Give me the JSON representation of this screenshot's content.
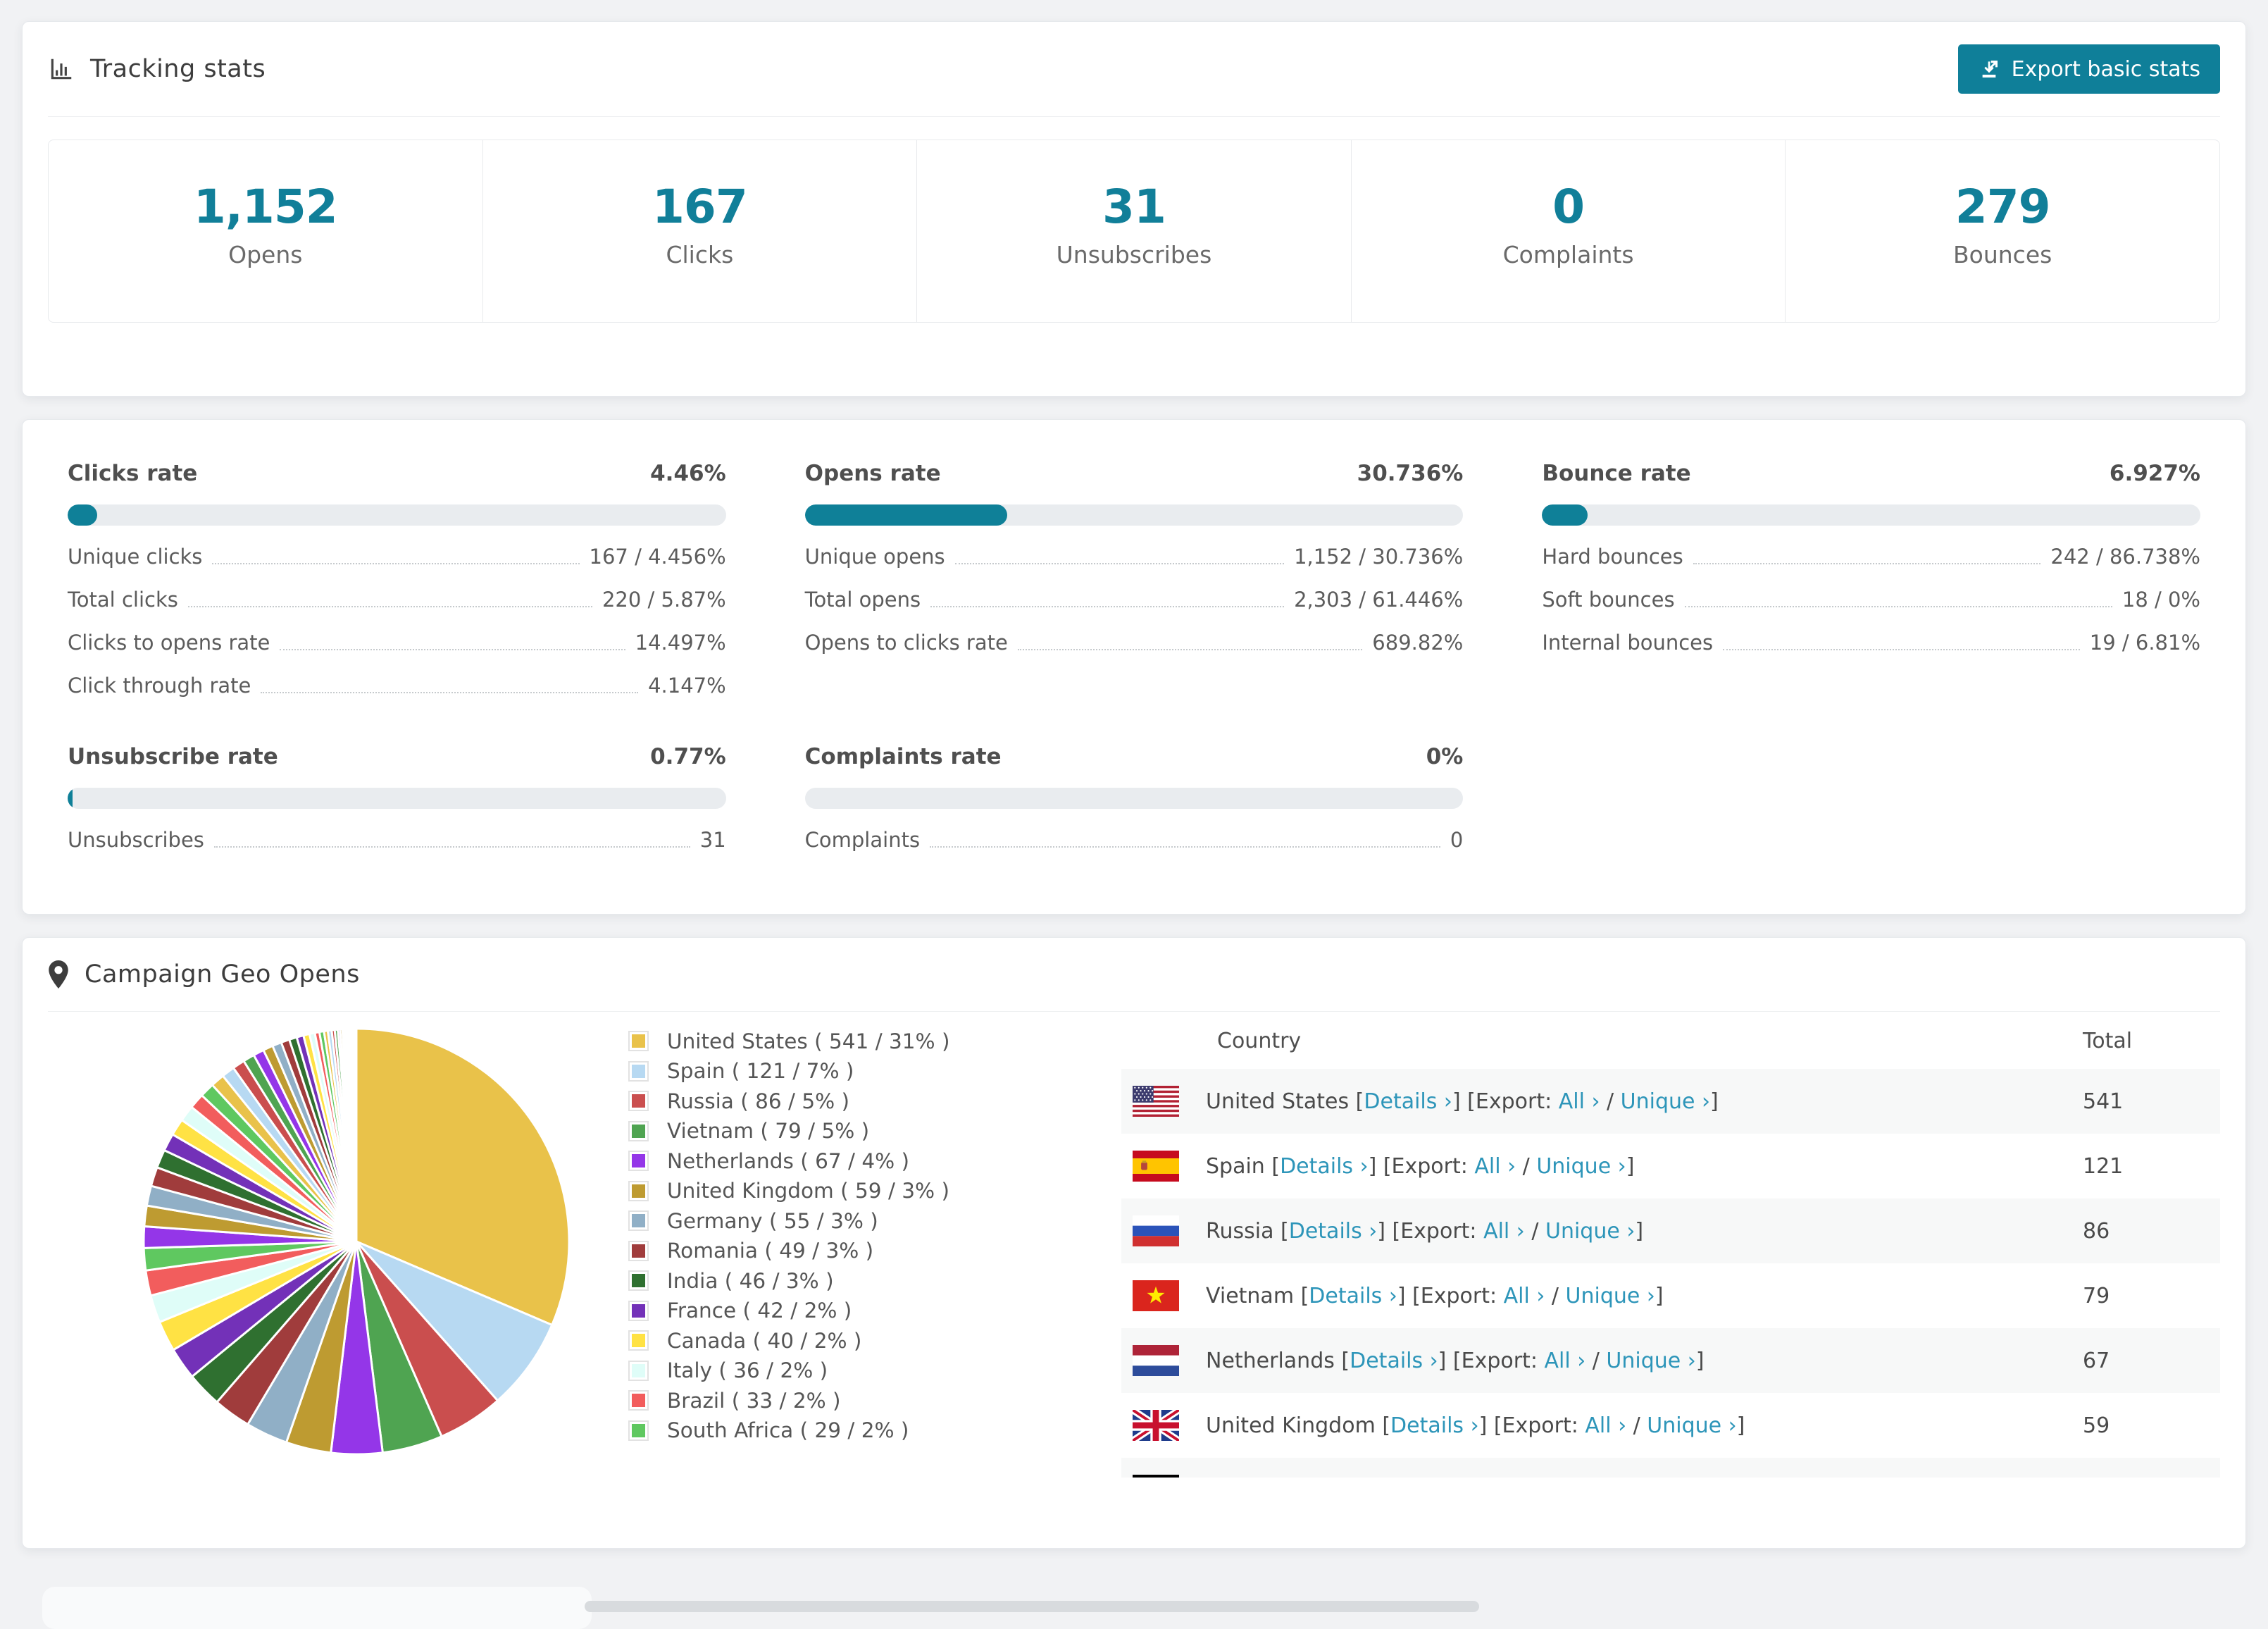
{
  "tracking": {
    "title": "Tracking stats",
    "export_button": "Export basic stats",
    "summary": [
      {
        "value": "1,152",
        "label": "Opens"
      },
      {
        "value": "167",
        "label": "Clicks"
      },
      {
        "value": "31",
        "label": "Unsubscribes"
      },
      {
        "value": "0",
        "label": "Complaints"
      },
      {
        "value": "279",
        "label": "Bounces"
      }
    ]
  },
  "rates": [
    {
      "title": "Clicks rate",
      "value": "4.46%",
      "percent": 4.46,
      "rows": [
        [
          "Unique clicks",
          "167 / 4.456%"
        ],
        [
          "Total clicks",
          "220 / 5.87%"
        ],
        [
          "Clicks to opens rate",
          "14.497%"
        ],
        [
          "Click through rate",
          "4.147%"
        ]
      ]
    },
    {
      "title": "Opens rate",
      "value": "30.736%",
      "percent": 30.736,
      "rows": [
        [
          "Unique opens",
          "1,152 / 30.736%"
        ],
        [
          "Total opens",
          "2,303 / 61.446%"
        ],
        [
          "Opens to clicks rate",
          "689.82%"
        ]
      ]
    },
    {
      "title": "Bounce rate",
      "value": "6.927%",
      "percent": 6.927,
      "rows": [
        [
          "Hard bounces",
          "242 / 86.738%"
        ],
        [
          "Soft bounces",
          "18 / 0%"
        ],
        [
          "Internal bounces",
          "19 / 6.81%"
        ]
      ]
    },
    {
      "title": "Unsubscribe rate",
      "value": "0.77%",
      "percent": 0.77,
      "rows": [
        [
          "Unsubscribes",
          "31"
        ]
      ]
    },
    {
      "title": "Complaints rate",
      "value": "0%",
      "percent": 0,
      "rows": [
        [
          "Complaints",
          "0"
        ]
      ]
    }
  ],
  "geo": {
    "title": "Campaign Geo Opens",
    "table_headers": {
      "country": "Country",
      "total": "Total"
    },
    "link_labels": {
      "details": "Details",
      "export": "Export:",
      "all": "All",
      "unique": "Unique",
      "arrow": "›"
    },
    "countries": [
      {
        "name": "United States",
        "count": 541,
        "pct": "31%",
        "color": "#E9C24A",
        "flag": "us"
      },
      {
        "name": "Spain",
        "count": 121,
        "pct": "7%",
        "color": "#B7D9F2",
        "flag": "es"
      },
      {
        "name": "Russia",
        "count": 86,
        "pct": "5%",
        "color": "#CA4E4E",
        "flag": "ru"
      },
      {
        "name": "Vietnam",
        "count": 79,
        "pct": "5%",
        "color": "#4FA451",
        "flag": "vn"
      },
      {
        "name": "Netherlands",
        "count": 67,
        "pct": "4%",
        "color": "#9436E8",
        "flag": "nl"
      },
      {
        "name": "United Kingdom",
        "count": 59,
        "pct": "3%",
        "color": "#BE9B31",
        "flag": "gb"
      },
      {
        "name": "Germany",
        "count": 55,
        "pct": "3%",
        "color": "#90AFC6",
        "flag": "de"
      },
      {
        "name": "Romania",
        "count": 49,
        "pct": "3%",
        "color": "#A03C3C",
        "flag": "ro"
      },
      {
        "name": "India",
        "count": 46,
        "pct": "3%",
        "color": "#2F7030",
        "flag": "in"
      },
      {
        "name": "France",
        "count": 42,
        "pct": "2%",
        "color": "#7331B8",
        "flag": "fr"
      },
      {
        "name": "Canada",
        "count": 40,
        "pct": "2%",
        "color": "#FFE244",
        "flag": "ca"
      },
      {
        "name": "Italy",
        "count": 36,
        "pct": "2%",
        "color": "#DFFDF8",
        "flag": "it"
      },
      {
        "name": "Brazil",
        "count": 33,
        "pct": "2%",
        "color": "#F25D5D",
        "flag": "br"
      },
      {
        "name": "South Africa",
        "count": 29,
        "pct": "2%",
        "color": "#5FC860",
        "flag": "za"
      }
    ],
    "table_row_count": 7
  },
  "chart_data": {
    "type": "pie",
    "title": "Campaign Geo Opens",
    "unit": "opens",
    "legend_position": "right",
    "start_angle_deg": -90,
    "direction": "clockwise",
    "series": [
      {
        "name": "United States",
        "value": 541,
        "pct": 31,
        "color": "#E9C24A"
      },
      {
        "name": "Spain",
        "value": 121,
        "pct": 7,
        "color": "#B7D9F2"
      },
      {
        "name": "Russia",
        "value": 86,
        "pct": 5,
        "color": "#CA4E4E"
      },
      {
        "name": "Vietnam",
        "value": 79,
        "pct": 5,
        "color": "#4FA451"
      },
      {
        "name": "Netherlands",
        "value": 67,
        "pct": 4,
        "color": "#9436E8"
      },
      {
        "name": "United Kingdom",
        "value": 59,
        "pct": 3,
        "color": "#BE9B31"
      },
      {
        "name": "Germany",
        "value": 55,
        "pct": 3,
        "color": "#90AFC6"
      },
      {
        "name": "Romania",
        "value": 49,
        "pct": 3,
        "color": "#A03C3C"
      },
      {
        "name": "India",
        "value": 46,
        "pct": 3,
        "color": "#2F7030"
      },
      {
        "name": "France",
        "value": 42,
        "pct": 2,
        "color": "#7331B8"
      },
      {
        "name": "Canada",
        "value": 40,
        "pct": 2,
        "color": "#FFE244"
      },
      {
        "name": "Italy",
        "value": 36,
        "pct": 2,
        "color": "#DFFDF8"
      },
      {
        "name": "Brazil",
        "value": 33,
        "pct": 2,
        "color": "#F25D5D"
      },
      {
        "name": "South Africa",
        "value": 29,
        "pct": 2,
        "color": "#5FC860"
      }
    ],
    "other_slices": {
      "note": "long tail of smaller countries (unlabeled slices)",
      "values": [
        28,
        27,
        26,
        25,
        24,
        23,
        22,
        21,
        20,
        19,
        18,
        17,
        16,
        15,
        14,
        13,
        12,
        11,
        10,
        9,
        8,
        7,
        6,
        6,
        5,
        5,
        4,
        4,
        3,
        3,
        2,
        2,
        2,
        2,
        1,
        1,
        1,
        1,
        1,
        1,
        1,
        1,
        1,
        1
      ],
      "color_cycle_offset": 4
    },
    "palette": [
      "#E9C24A",
      "#B7D9F2",
      "#CA4E4E",
      "#4FA451",
      "#9436E8",
      "#BE9B31",
      "#90AFC6",
      "#A03C3C",
      "#2F7030",
      "#7331B8",
      "#FFE244",
      "#DFFDF8",
      "#F25D5D",
      "#5FC860"
    ]
  }
}
